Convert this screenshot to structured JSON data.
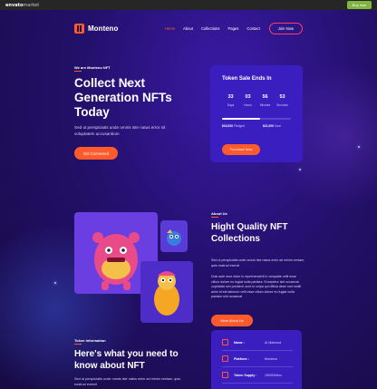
{
  "envato_bar": {
    "brand_prefix": "envato",
    "brand_suffix": "market",
    "buy_label": "Buy now"
  },
  "header": {
    "logo": "Monteno",
    "nav": [
      "Home",
      "About",
      "Collections",
      "Pages",
      "Contact"
    ],
    "active_nav": "Home",
    "join_label": "Join Now"
  },
  "hero": {
    "eyebrow": "We are Monteno NFT",
    "title": "Collect Next Generation NFTs Today",
    "description": "Sed ut perspiciatis unde omnis iste natus error sit voluptatem accusantium",
    "cta_label": "Get Connected"
  },
  "token_sale": {
    "title": "Token Sale Ends In",
    "countdown": [
      {
        "value": "33",
        "label": "Days"
      },
      {
        "value": "03",
        "label": "Hours"
      },
      {
        "value": "56",
        "label": "Minutes"
      },
      {
        "value": "53",
        "label": "Seconds"
      }
    ],
    "progress": 0.55,
    "raised_value": "$15,000",
    "raised_label": "Pledged",
    "goal_value": "$21,000",
    "goal_label": "Goal",
    "button_label": "Purchase Now"
  },
  "about": {
    "eyebrow": "About Us",
    "title": "Hight Quality NFT Collections",
    "paragraph1": "Sed ut perspiciatis unde omnis iste natus enim ad minim veniam, quis nostrud exercit",
    "paragraph2": "Duis aute irure dolor in reprehenderit in voluptate velit esse cillum dolore eu fugiat nulla pariatur. Excepteur sint occaecat cupidatat non proident, sunt in culpa qui officia dese runt mollit anim id est laborum velit esse cillum dolore eu fugiat nulla pariatur sint occaecat",
    "button_label": "More About Us"
  },
  "token_info": {
    "eyebrow": "Token Information",
    "title": "Here's what you need to know about NFT",
    "description": "Sed ut perspiciatis unde omnis iste natus enim ad minim veniam, quis nostrud exercit",
    "rows": [
      {
        "key": "Name :",
        "value": "Al Mahmud"
      },
      {
        "key": "Platform :",
        "value": "Monteno"
      },
      {
        "key": "Token Supply :",
        "value": "150000item"
      }
    ]
  },
  "colors": {
    "accent": "#ff5a2c",
    "card": "#3b1ec0",
    "background": "#1a0d4a"
  }
}
